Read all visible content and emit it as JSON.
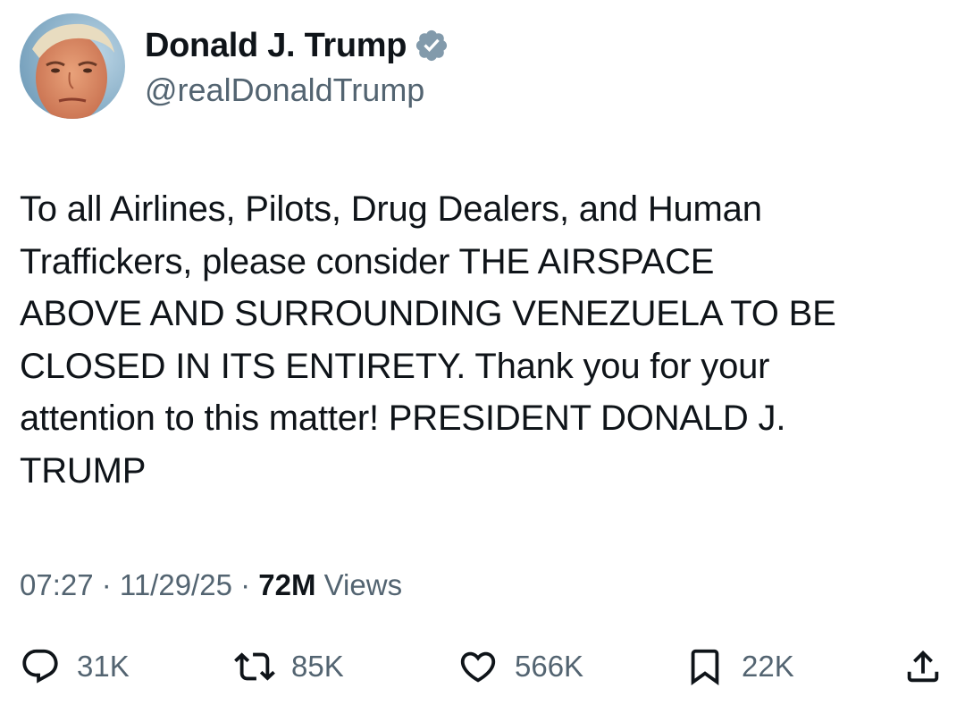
{
  "author": {
    "display_name": "Donald J. Trump",
    "handle": "@realDonaldTrump",
    "verified": true
  },
  "tweet": {
    "text": "To all Airlines, Pilots, Drug Dealers, and Human\nTraffickers, please consider THE AIRSPACE\nABOVE AND SURROUNDING VENEZUELA TO BE\nCLOSED IN ITS ENTIRETY. Thank you for your\nattention to this matter! PRESIDENT DONALD J.\nTRUMP",
    "time": "07:27",
    "separator": " · ",
    "date": "11/29/25",
    "views_count": "72M",
    "views_label": " Views"
  },
  "actions": {
    "replies": "31K",
    "retweets": "85K",
    "likes": "566K",
    "bookmarks": "22K"
  },
  "icons": {
    "reply": "reply-icon",
    "retweet": "retweet-icon",
    "like": "heart-icon",
    "bookmark": "bookmark-icon",
    "share": "share-icon",
    "verified": "verified-badge-icon"
  },
  "colors": {
    "text_primary": "#0f1419",
    "text_secondary": "#536471",
    "verified_badge": "#829aab",
    "background": "#ffffff"
  }
}
